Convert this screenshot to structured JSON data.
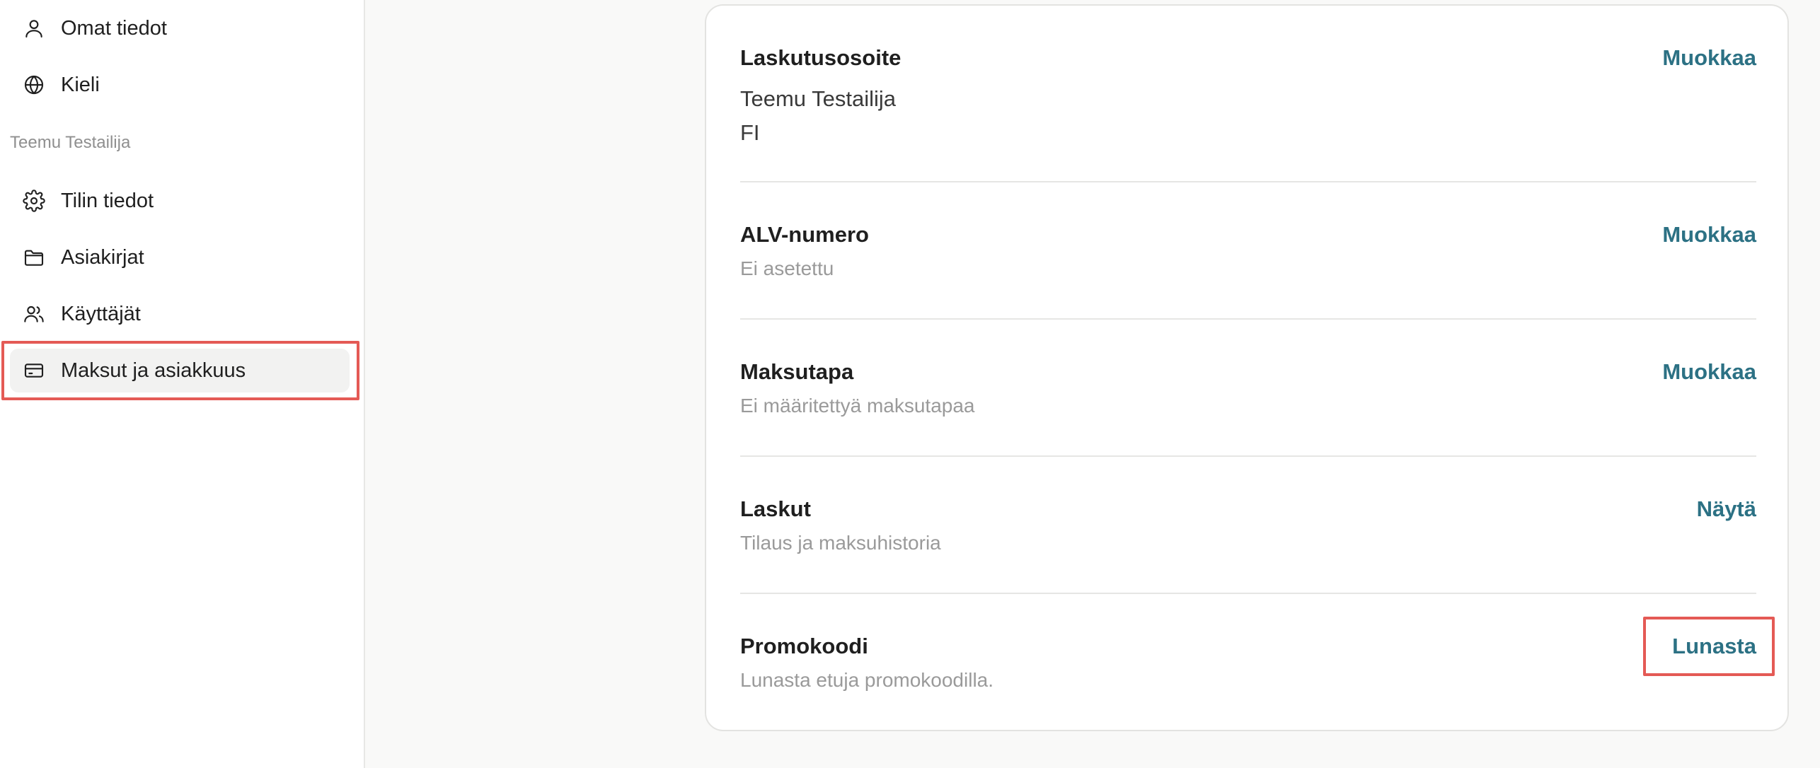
{
  "sidebar": {
    "items_top": [
      {
        "label": "Omat tiedot",
        "icon": "user-icon"
      },
      {
        "label": "Kieli",
        "icon": "globe-icon"
      }
    ],
    "section_heading": "Teemu Testailija",
    "items_account": [
      {
        "label": "Tilin tiedot",
        "icon": "gear-icon"
      },
      {
        "label": "Asiakirjat",
        "icon": "folder-icon"
      },
      {
        "label": "Käyttäjät",
        "icon": "users-icon"
      },
      {
        "label": "Maksut ja asiakkuus",
        "icon": "credit-card-icon",
        "active": true
      }
    ]
  },
  "billing": {
    "address": {
      "title": "Laskutusosoite",
      "action": "Muokkaa",
      "lines": [
        "Teemu Testailija",
        "FI"
      ]
    },
    "vat": {
      "title": "ALV-numero",
      "subtitle": "Ei asetettu",
      "action": "Muokkaa"
    },
    "payment_method": {
      "title": "Maksutapa",
      "subtitle": "Ei määritettyä maksutapaa",
      "action": "Muokkaa"
    },
    "invoices": {
      "title": "Laskut",
      "subtitle": "Tilaus ja maksuhistoria",
      "action": "Näytä"
    },
    "promo": {
      "title": "Promokoodi",
      "subtitle": "Lunasta etuja promokoodilla.",
      "action": "Lunasta"
    }
  },
  "colors": {
    "accent": "#2c7184",
    "highlight": "#e45a55",
    "muted_text": "#9a9a9a"
  }
}
